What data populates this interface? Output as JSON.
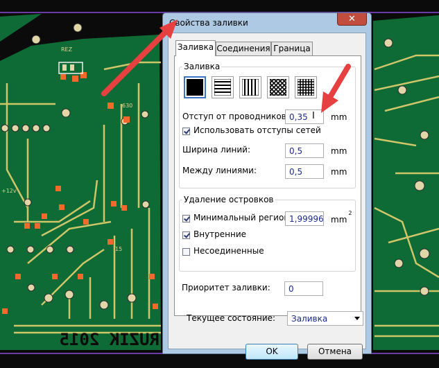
{
  "dialog": {
    "title": "Свойства заливки",
    "close_glyph": "✕",
    "tabs": [
      {
        "label": "Заливка",
        "active": true
      },
      {
        "label": "Соединения",
        "active": false
      },
      {
        "label": "Граница",
        "active": false
      }
    ],
    "fill_group": {
      "title": "Заливка",
      "patterns": [
        {
          "name": "solid-fill-icon",
          "selected": true
        },
        {
          "name": "horizontal-lines-icon",
          "selected": false
        },
        {
          "name": "vertical-lines-icon",
          "selected": false
        },
        {
          "name": "diagonal-crosshatch-icon",
          "selected": false
        },
        {
          "name": "grid-crosshatch-icon",
          "selected": false
        }
      ],
      "clearance_label": "Отступ от проводников:",
      "clearance_value": "0,35",
      "clearance_unit": "mm",
      "use_net_clearance_label": "Использовать отступы сетей",
      "use_net_clearance_checked": true,
      "line_width_label": "Ширина линий:",
      "line_width_value": "0,5",
      "line_width_unit": "mm",
      "line_spacing_label": "Между линиями:",
      "line_spacing_value": "0,5",
      "line_spacing_unit": "mm"
    },
    "islands_group": {
      "title": "Удаление островков",
      "min_region_label": "Минимальный регион:",
      "min_region_checked": true,
      "min_region_value": "1,99996",
      "min_region_unit": "mm",
      "min_region_unit_sup": "2",
      "inner_label": "Внутренние",
      "inner_checked": true,
      "unconnected_label": "Несоединенные",
      "unconnected_checked": false
    },
    "priority_label": "Приоритет заливки:",
    "priority_value": "0",
    "state_label": "Текущее состояние:",
    "state_value": "Заливка",
    "ok_label": "OK",
    "cancel_label": "Отмена"
  },
  "board": {
    "silk_text": "RUZIK 2015",
    "label_630": "630",
    "label_12v": "+12v",
    "label_15": "15",
    "label_rez": "REZ"
  },
  "colors": {
    "board_bg": "#0b0b0b",
    "copper": "#0f6b36",
    "copper_light": "#1f8a48",
    "trace": "#cfc66a",
    "pad_orange": "#f06a2e",
    "arrow": "#e64040",
    "dialog_frame": "#aec9e3",
    "close_button": "#c24d3f"
  }
}
